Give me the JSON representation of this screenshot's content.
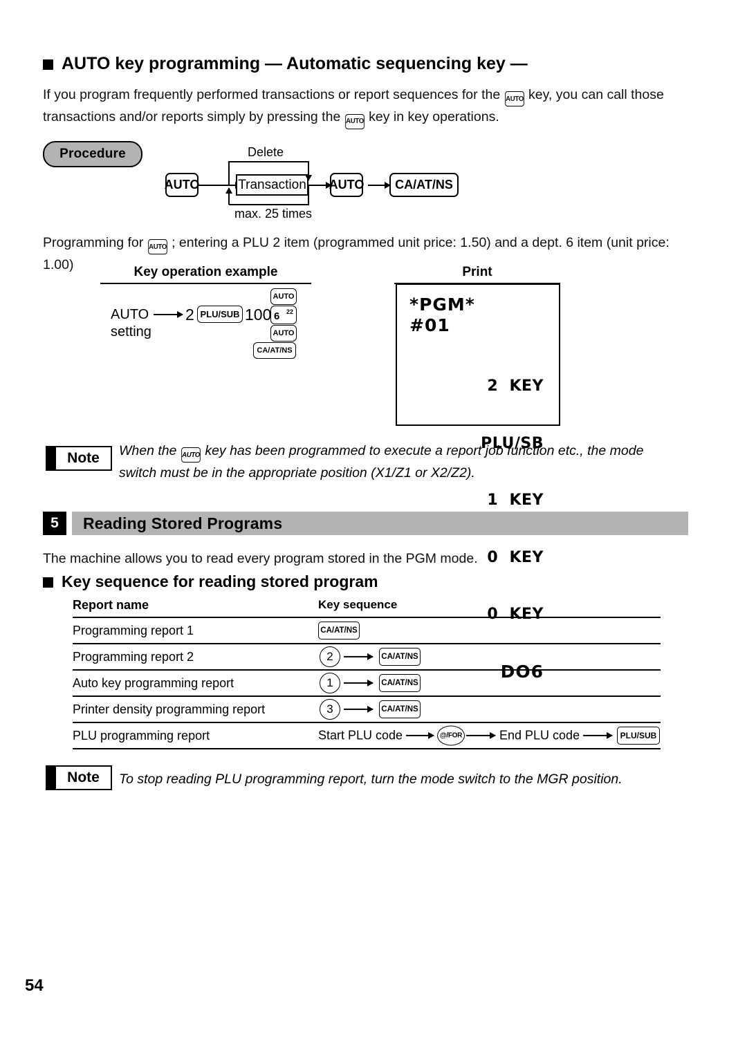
{
  "page": {
    "number": "54"
  },
  "section_auto": {
    "heading": "AUTO key programming — Automatic sequencing key —",
    "intro_part1": "If you program frequently performed transactions or report sequences for the",
    "intro_part2": "key, you can call those transactions and/or reports simply by pressing the",
    "intro_part3": "key in key operations.",
    "procedure_label": "Procedure",
    "programming_note_part1": "Programming for",
    "programming_note_part2": "; entering a PLU 2 item (programmed unit price: 1.50) and a dept. 6 item (unit price: 1.00)"
  },
  "procedure_diagram": {
    "key_auto_1": "AUTO",
    "transaction_box": "Transaction",
    "key_auto_2": "AUTO",
    "key_cash": "CA/AT/NS",
    "label_delete": "Delete",
    "label_max": "max. 25 times"
  },
  "example": {
    "col_key_operation": "Key operation example",
    "col_print": "Print",
    "auto_line1": "AUTO",
    "auto_line2": "setting",
    "num_2": "2",
    "key_plusub": "PLU/SUB",
    "num_100": "100",
    "key_dept_main": "6",
    "key_dept_sup": "22",
    "key_auto_top": "AUTO",
    "key_auto_bottom": "AUTO",
    "key_cash": "CA/AT/NS"
  },
  "receipt": {
    "title": "*PGM*",
    "subtitle": "#01",
    "lines": [
      "2  KEY",
      "PLU/SB",
      "1  KEY",
      "0  KEY",
      "0  KEY"
    ],
    "footer": "DO6"
  },
  "note1": {
    "label": "Note",
    "text_part1": "When the",
    "text_part2": "key has been programmed to execute a report job function etc., the mode switch must be in the appropriate position (X1/Z1 or X2/Z2)."
  },
  "section5": {
    "number": "5",
    "title": "Reading Stored Programs",
    "description": "The machine allows you to read every program stored in the PGM mode.",
    "subheading": "Key sequence for reading stored program"
  },
  "key_sequence_table": {
    "headers": {
      "report_name": "Report name",
      "key_sequence": "Key sequence"
    },
    "rows": [
      {
        "name": "Programming report 1",
        "keys": {
          "cash": "CA/AT/NS"
        }
      },
      {
        "name": "Programming report 2",
        "keys": {
          "circle": "2",
          "cash": "CA/AT/NS"
        }
      },
      {
        "name": "Auto key programming report",
        "keys": {
          "circle": "1",
          "cash": "CA/AT/NS"
        }
      },
      {
        "name": "Printer density programming report",
        "keys": {
          "circle": "3",
          "cash": "CA/AT/NS"
        }
      },
      {
        "name": "PLU programming report",
        "keys": {
          "start_text": "Start PLU code",
          "oval": "@/FOR",
          "end_text": "End PLU code",
          "plusub": "PLU/SUB"
        }
      }
    ]
  },
  "note2": {
    "label": "Note",
    "text": "To stop reading PLU programming report, turn the mode switch to the MGR position."
  },
  "colors": {
    "gray_bar": "#b3b3b3",
    "black": "#000000",
    "white": "#ffffff"
  }
}
